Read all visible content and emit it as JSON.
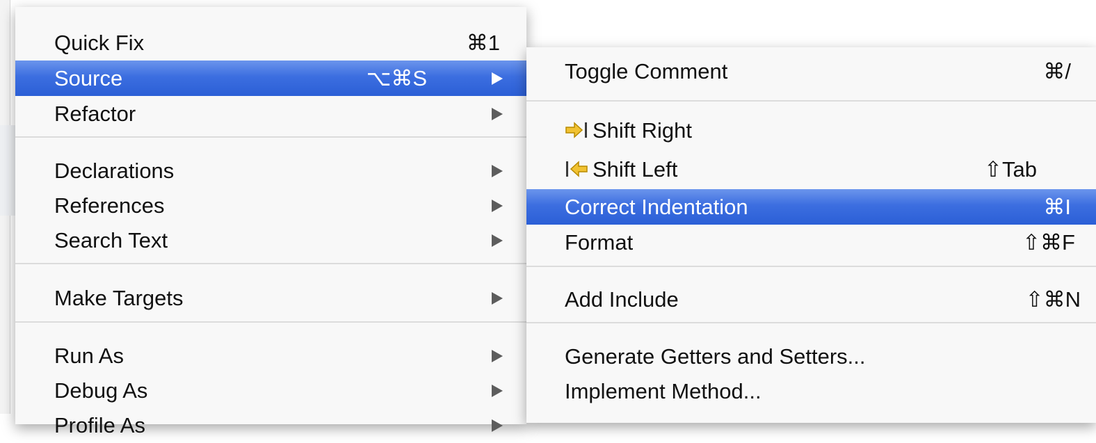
{
  "primary_menu": {
    "items": [
      {
        "label": "Quick Fix",
        "shortcut": "⌘1"
      },
      {
        "label": "Source",
        "shortcut": "⌥⌘S",
        "selected": true
      },
      {
        "label": "Refactor"
      },
      {
        "label": "Declarations"
      },
      {
        "label": "References"
      },
      {
        "label": "Search Text"
      },
      {
        "label": "Make Targets"
      },
      {
        "label": "Run As"
      },
      {
        "label": "Debug As"
      },
      {
        "label": "Profile As"
      }
    ]
  },
  "source_submenu": {
    "items": [
      {
        "label": "Toggle Comment",
        "shortcut": "⌘/"
      },
      {
        "label": "Shift Right",
        "icon": "shift-right-icon"
      },
      {
        "label": "Shift Left",
        "icon": "shift-left-icon",
        "shortcut": "⇧Tab"
      },
      {
        "label": "Correct Indentation",
        "shortcut": "⌘I",
        "selected": true
      },
      {
        "label": "Format",
        "shortcut": "⇧⌘F"
      },
      {
        "label": "Add Include",
        "shortcut": "⇧⌘N"
      },
      {
        "label": "Generate Getters and Setters..."
      },
      {
        "label": "Implement Method..."
      }
    ]
  },
  "colors": {
    "selection": "#3c6ee0",
    "menu_background": "#f8f8f8",
    "shift_icon": "#e6b800"
  }
}
